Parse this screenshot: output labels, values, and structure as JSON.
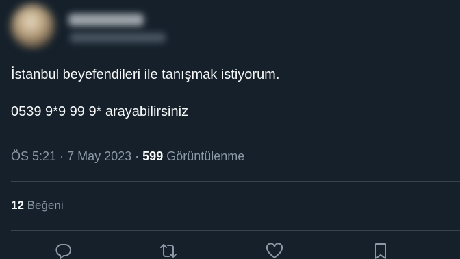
{
  "tweet": {
    "text_line1": "İstanbul beyefendileri ile tanışmak istiyorum.",
    "text_line2": "0539 9*9 99 9* arayabilirsiniz",
    "time": "ÖS 5:21",
    "separator": "·",
    "date": "7 May 2023",
    "views_count": "599",
    "views_label": "Görüntülenme",
    "likes_count": "12",
    "likes_label": "Beğeni"
  },
  "icons": {
    "reply": "reply-icon",
    "retweet": "retweet-icon",
    "like": "heart-icon",
    "bookmark": "bookmark-icon"
  },
  "colors": {
    "background": "#15202b",
    "text": "#f7f9f9",
    "muted": "#8b98a5",
    "divider": "#38444d"
  }
}
